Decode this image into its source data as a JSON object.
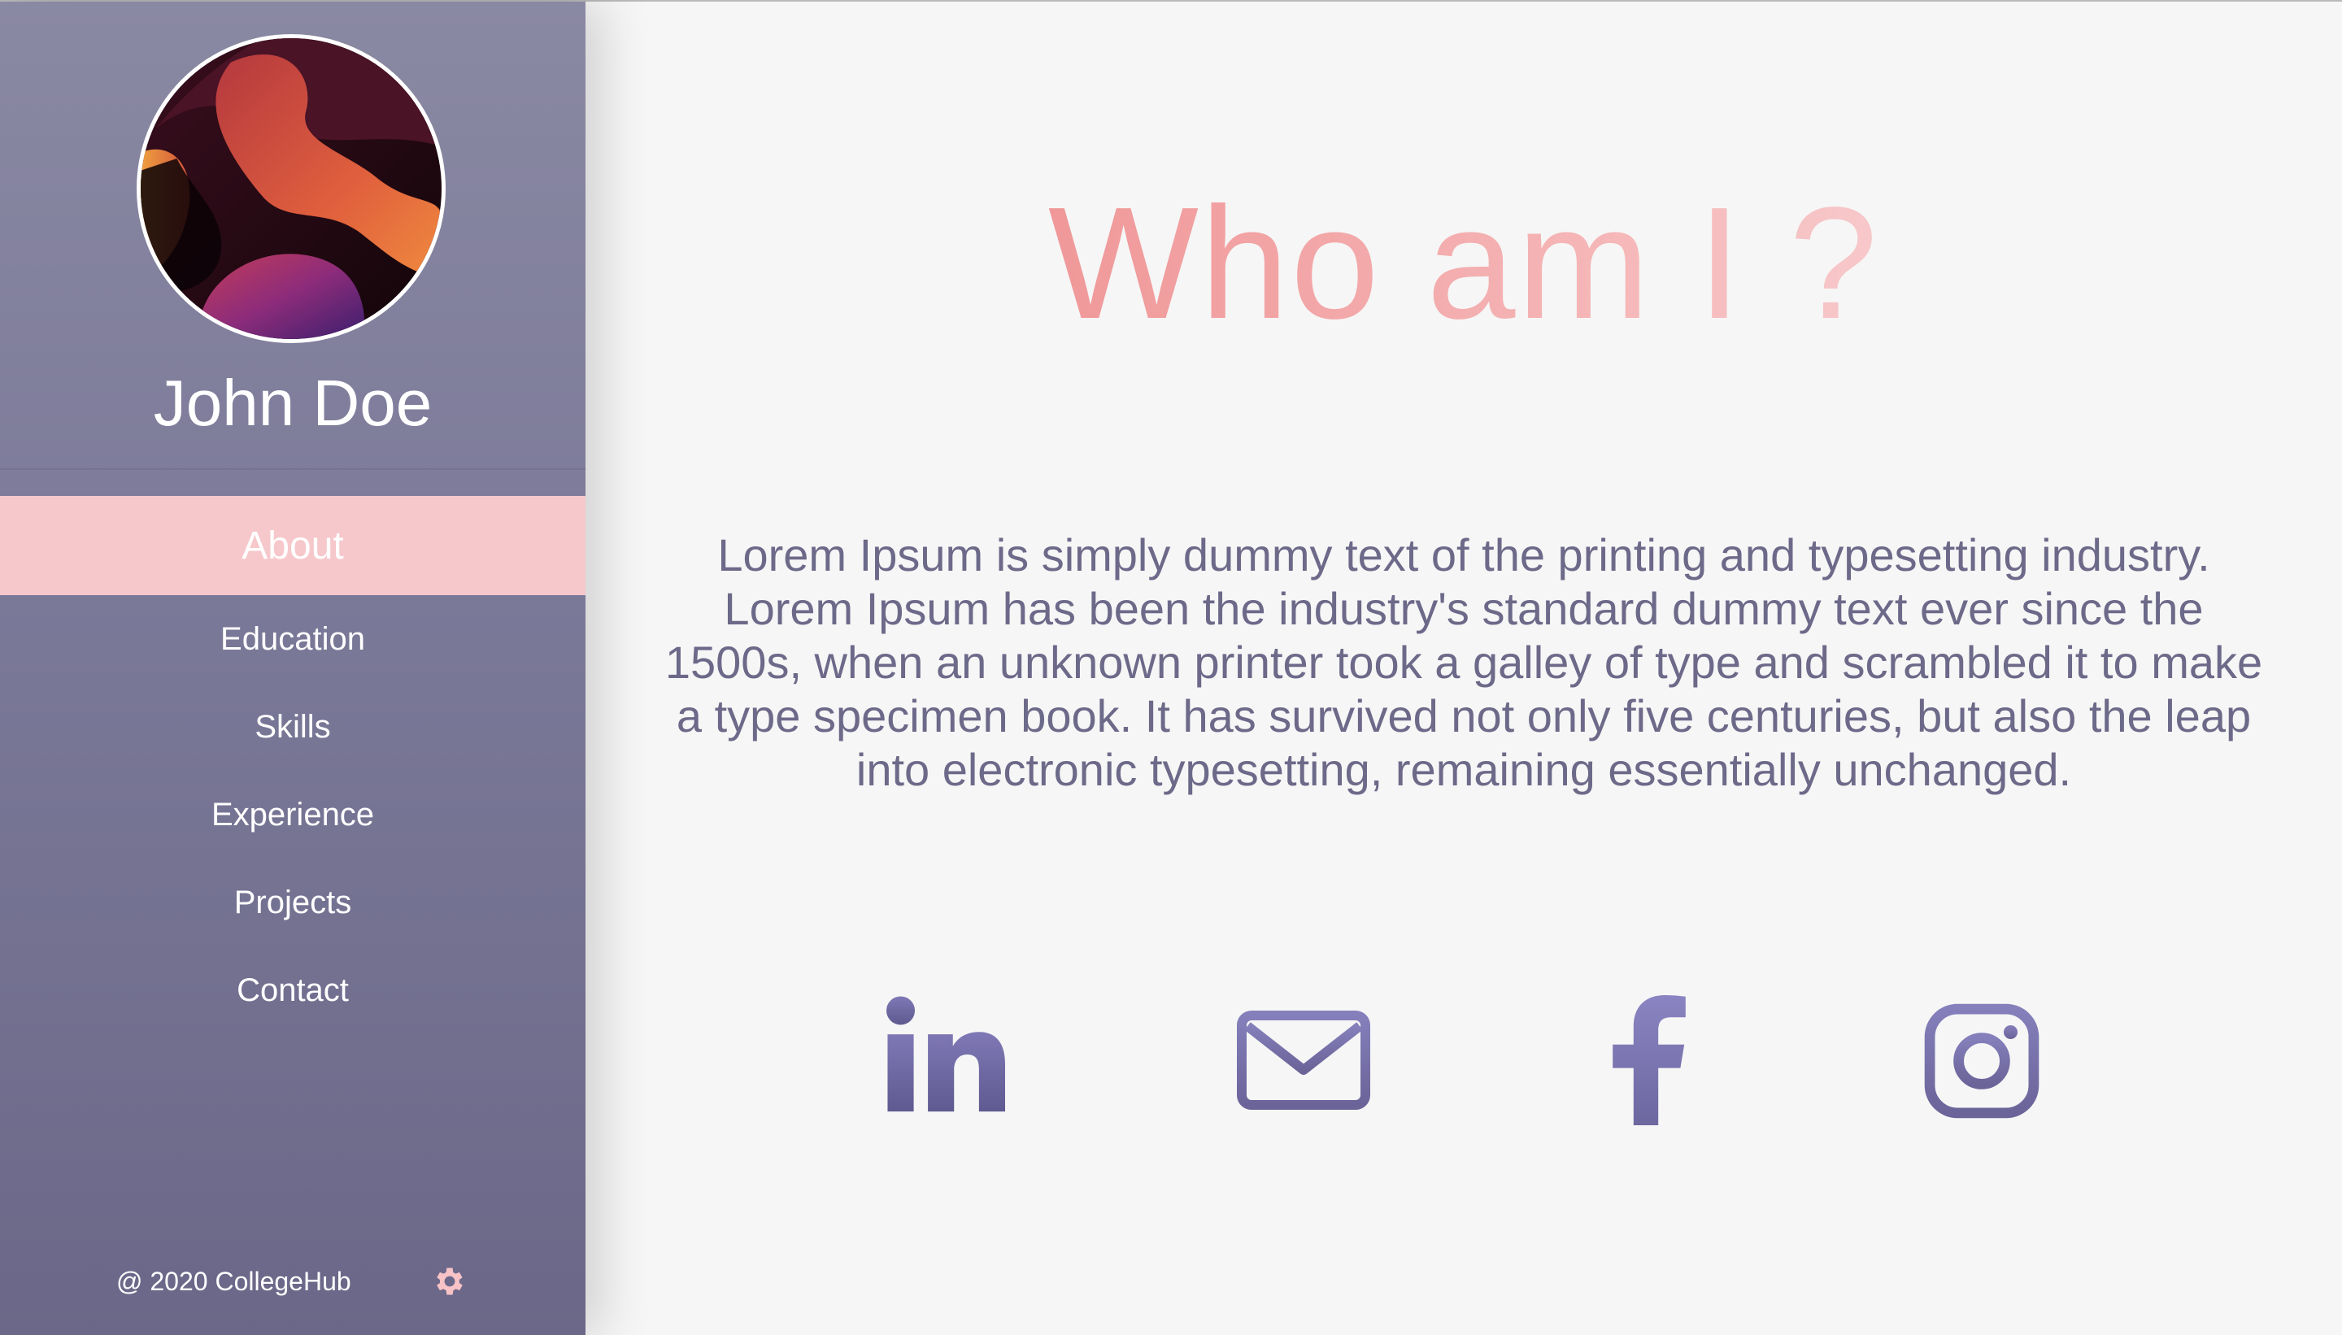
{
  "profile": {
    "name": "John Doe"
  },
  "nav": {
    "items": [
      {
        "label": "About",
        "active": true
      },
      {
        "label": "Education",
        "active": false
      },
      {
        "label": "Skills",
        "active": false
      },
      {
        "label": "Experience",
        "active": false
      },
      {
        "label": "Projects",
        "active": false
      },
      {
        "label": "Contact",
        "active": false
      }
    ]
  },
  "footer": {
    "copyright": "@ 2020 CollegeHub",
    "settings_icon": "gear-icon"
  },
  "main": {
    "title": "Who am I ?",
    "bio": "Lorem Ipsum is simply dummy text of the printing and typesetting industry. Lorem Ipsum has been the industry's standard dummy text ever since the 1500s, when an unknown printer took a galley of type and scrambled it to make a type specimen book. It has survived not only five centuries, but also the leap into electronic typesetting, remaining essentially unchanged."
  },
  "social": [
    {
      "icon": "linkedin-icon"
    },
    {
      "icon": "mail-icon"
    },
    {
      "icon": "facebook-icon"
    },
    {
      "icon": "instagram-icon"
    }
  ],
  "colors": {
    "sidebar_top": "#8a89a3",
    "sidebar_bottom": "#6b6788",
    "active_nav": "#f6c8cb",
    "title_start": "#f09899",
    "title_end": "#f7c8ca",
    "text": "#6c6989",
    "icon": "#7a74b0",
    "background": "#f6f6f6"
  }
}
